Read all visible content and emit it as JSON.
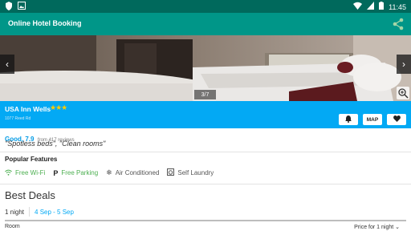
{
  "status_bar": {
    "time": "11:45"
  },
  "app_bar": {
    "title": "Online Hotel Booking"
  },
  "gallery": {
    "counter": "3/7",
    "prev": "‹",
    "next": "›"
  },
  "hotel": {
    "name": "USA Inn Wells",
    "stars": "★★★",
    "address": "1077 Reed Rd",
    "rating": 3,
    "buttons": {
      "map": "MAP"
    }
  },
  "review": {
    "score_text": "Good, 7.9",
    "count_text": "from 417 reviews",
    "quote": "\"Spotless beds\", \"Clean rooms\""
  },
  "features": {
    "heading": "Popular Features",
    "items": [
      {
        "label": "Free Wi-Fi",
        "icon": "wifi-icon",
        "color": "#4caf50"
      },
      {
        "label": "Free Parking",
        "icon": "parking-icon",
        "color": "#4caf50"
      },
      {
        "label": "Air Conditioned",
        "icon": "snowflake-icon",
        "color": "#555555"
      },
      {
        "label": "Self Laundry",
        "icon": "laundry-icon",
        "color": "#555555"
      }
    ]
  },
  "deals": {
    "heading": "Best Deals",
    "nights": "1 night",
    "range": "4 Sep - 5 Sep"
  },
  "table": {
    "col_room": "Room",
    "col_price": "Price for 1 night ⌄"
  },
  "colors": {
    "primary_dark": "#00695c",
    "primary": "#009688",
    "accent": "#03a9f4"
  }
}
